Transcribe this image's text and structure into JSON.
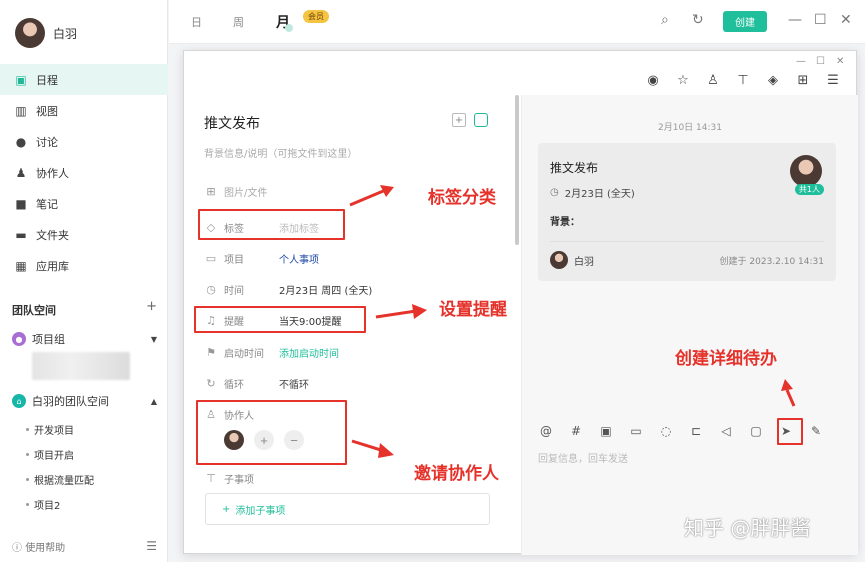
{
  "sidebar": {
    "user_name": "白羽",
    "nav": [
      {
        "label": "日程",
        "icon": "calendar-icon"
      },
      {
        "label": "视图",
        "icon": "chart-icon"
      },
      {
        "label": "讨论",
        "icon": "chat-icon"
      },
      {
        "label": "协作人",
        "icon": "people-icon"
      },
      {
        "label": "笔记",
        "icon": "note-icon"
      },
      {
        "label": "文件夹",
        "icon": "folder-icon"
      },
      {
        "label": "应用库",
        "icon": "apps-icon"
      }
    ],
    "team_space_title": "团队空间",
    "groups": [
      {
        "label": "项目组"
      },
      {
        "label": "白羽的团队空间"
      }
    ],
    "sub_items": [
      "开发项目",
      "项目开启",
      "根据流量匹配",
      "项目2"
    ],
    "help_label": "使用帮助"
  },
  "topbar": {
    "tabs": [
      "日",
      "周",
      "月"
    ],
    "vip_badge": "会员",
    "create_label": "创建"
  },
  "detail": {
    "title": "推文发布",
    "description_placeholder": "背景信息/说明（可拖文件到这里）",
    "fields": {
      "image_label": "图片/文件",
      "tag_label": "标签",
      "tag_value": "添加标签",
      "project_label": "项目",
      "project_value": "个人事项",
      "time_label": "时间",
      "time_value": "2月23日 周四 (全天)",
      "reminder_label": "提醒",
      "reminder_value": "当天9:00提醒",
      "start_label": "启动时间",
      "start_value": "添加启动时间",
      "repeat_label": "循环",
      "repeat_value": "不循环",
      "collab_label": "协作人",
      "subtask_label": "子事项",
      "add_subtask": "添加子事项"
    }
  },
  "activity": {
    "timestamp": "2月10日 14:31",
    "card": {
      "title": "推文发布",
      "date": "2月23日 (全天)",
      "background_label": "背景：",
      "member_badge": "共1人",
      "user": "白羽",
      "meta": "创建于 2023.2.10 14:31"
    },
    "compose_placeholder": "回复信息，回车发送"
  },
  "annotations": {
    "tag": "标签分类",
    "reminder": "设置提醒",
    "collab": "邀请协作人",
    "create_todo": "创建详细待办"
  },
  "watermark": "知乎 @胖胖酱",
  "colors": {
    "accent": "#1fbf9b",
    "annotation": "#e5322b"
  }
}
